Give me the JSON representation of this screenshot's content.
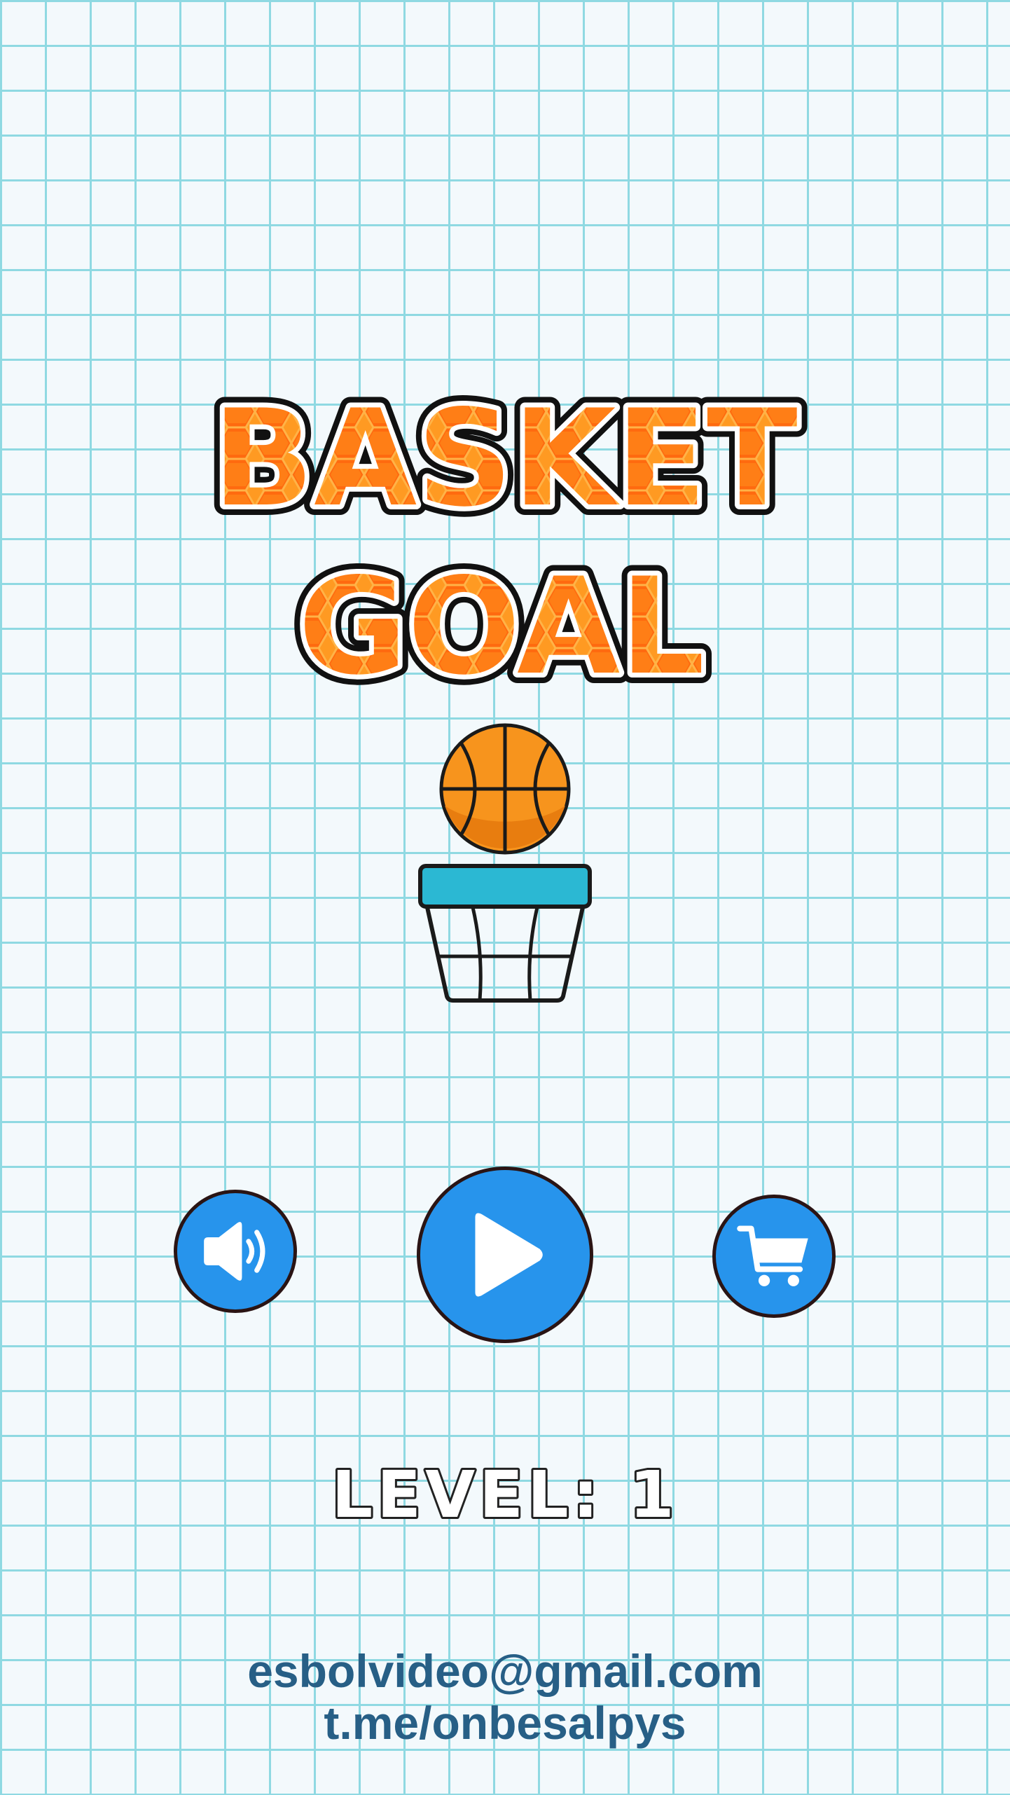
{
  "title": {
    "line1": "BASKET",
    "line2": "GOAL"
  },
  "colors": {
    "title_fill": "#ff8a1c",
    "title_pattern": "#ff5a0a",
    "button_blue": "#2794ec",
    "hoop_rim": "#2bb8d3",
    "ball_orange": "#f7941d",
    "grid_line": "#8fd9e2",
    "contact_text": "#275f86"
  },
  "buttons": {
    "sound": {
      "icon": "speaker-icon"
    },
    "play": {
      "icon": "play-icon"
    },
    "shop": {
      "icon": "cart-icon"
    }
  },
  "level": {
    "text": "LEVEL: 1"
  },
  "contact": {
    "email": "esbolvideo@gmail.com",
    "telegram": "t.me/onbesalpys"
  }
}
